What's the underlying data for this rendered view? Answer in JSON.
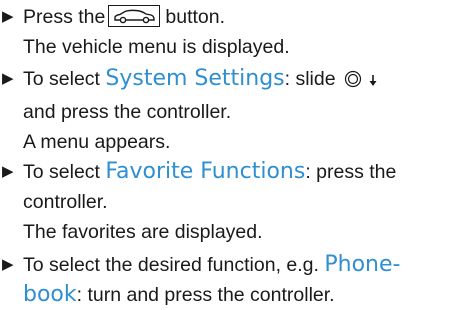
{
  "steps": [
    {
      "lines": [
        {
          "before": "Press the",
          "icon": "vehicle-car-icon",
          "after": "button."
        },
        {
          "text": "The vehicle menu is displayed."
        }
      ]
    },
    {
      "lines": [
        {
          "before": "To select",
          "highlight": "System Settings",
          "after": ": slide"
        },
        {
          "text": "and press the controller."
        },
        {
          "text": "A menu appears."
        }
      ]
    },
    {
      "lines": [
        {
          "before": "To select",
          "highlight": "Favorite Functions",
          "after": ": press the"
        },
        {
          "text": "controller."
        },
        {
          "text": "The favorites are displayed."
        }
      ]
    },
    {
      "lines": [
        {
          "before": "To select the desired function, e.g.",
          "highlight": "Phone-"
        },
        {
          "highlight": "book",
          "after": ": turn and press the controller."
        }
      ]
    }
  ],
  "colors": {
    "highlight": "#2f8fd0",
    "text": "#1a1a1a"
  },
  "icons": {
    "bullet": "right-triangle-icon",
    "controller": "controller-icon",
    "slide": "slide-down-arrow-icon"
  }
}
